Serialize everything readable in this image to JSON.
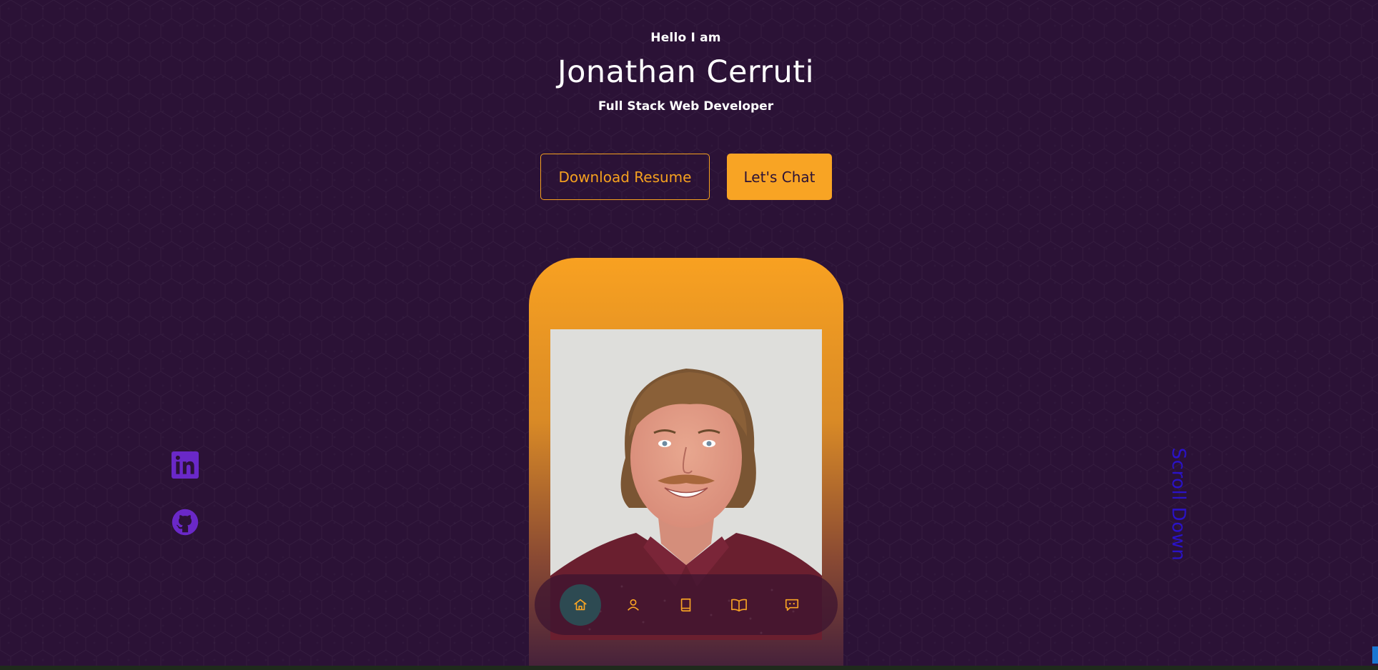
{
  "hero": {
    "greeting": "Hello I am",
    "name": "Jonathan Cerruti",
    "role": "Full Stack Web Developer"
  },
  "actions": {
    "download_label": "Download Resume",
    "chat_label": "Let's Chat"
  },
  "nav": {
    "items": [
      {
        "icon": "home-icon",
        "active": true
      },
      {
        "icon": "user-icon",
        "active": false
      },
      {
        "icon": "book-icon",
        "active": false
      },
      {
        "icon": "open-book-icon",
        "active": false
      },
      {
        "icon": "chat-icon",
        "active": false
      }
    ]
  },
  "social": {
    "linkedin_icon": "linkedin-icon",
    "github_icon": "github-icon"
  },
  "scroll": {
    "label": "Scroll Down"
  },
  "colors": {
    "background": "#2b1236",
    "accent": "#f8a424",
    "social": "#6a28c8",
    "scroll_text": "#2a12c8",
    "nav_active": "#2d4a52"
  }
}
